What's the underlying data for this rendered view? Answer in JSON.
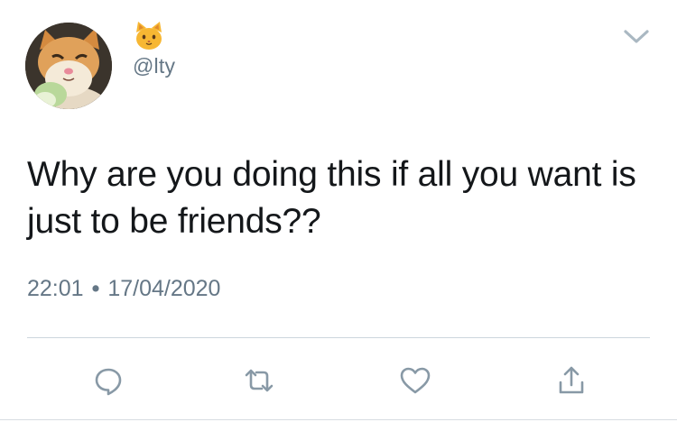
{
  "tweet": {
    "author": {
      "display_name_emoji": "cat-face-emoji",
      "handle": "@lty",
      "avatar": "crying-cat-photo"
    },
    "text": "Why are you doing this if all you want is just to be friends??",
    "time": "22:01",
    "separator": "•",
    "date": "17/04/2020"
  },
  "actions": [
    {
      "name": "reply",
      "icon": "speech-bubble-icon"
    },
    {
      "name": "retweet",
      "icon": "retweet-icon"
    },
    {
      "name": "like",
      "icon": "heart-icon"
    },
    {
      "name": "share",
      "icon": "share-icon"
    }
  ],
  "colors": {
    "text": "#14171a",
    "secondary": "#657786",
    "divider": "#ccd6dd",
    "emoji": "#f7b733"
  }
}
